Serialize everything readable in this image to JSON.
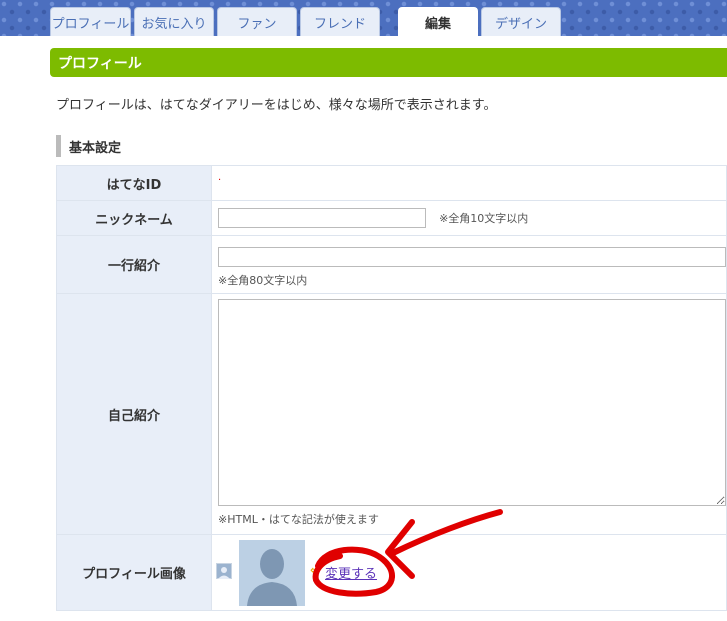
{
  "tabs": [
    {
      "label": "プロフィール"
    },
    {
      "label": "お気に入り"
    },
    {
      "label": "ファン"
    },
    {
      "label": "フレンド"
    },
    {
      "label": "編集"
    },
    {
      "label": "デザイン"
    }
  ],
  "section_title": "プロフィール",
  "intro_text": "プロフィールは、はてなダイアリーをはじめ、様々な場所で表示されます。",
  "subsection_title": "基本設定",
  "form": {
    "hatena_id": {
      "label": "はてなID",
      "value": "·"
    },
    "nickname": {
      "label": "ニックネーム",
      "value": "",
      "hint": "※全角10文字以内"
    },
    "oneliner": {
      "label": "一行紹介",
      "value": "",
      "hint": "※全角80文字以内"
    },
    "bio": {
      "label": "自己紹介",
      "value": "",
      "hint": "※HTML・はてな記法が使えます"
    },
    "profile_image": {
      "label": "プロフィール画像",
      "change_link": "変更する",
      "arrow": "⇐"
    }
  },
  "colors": {
    "header_green": "#7dbb00",
    "tab_blue": "#4a6fb5",
    "annotation_red": "#e00000"
  }
}
